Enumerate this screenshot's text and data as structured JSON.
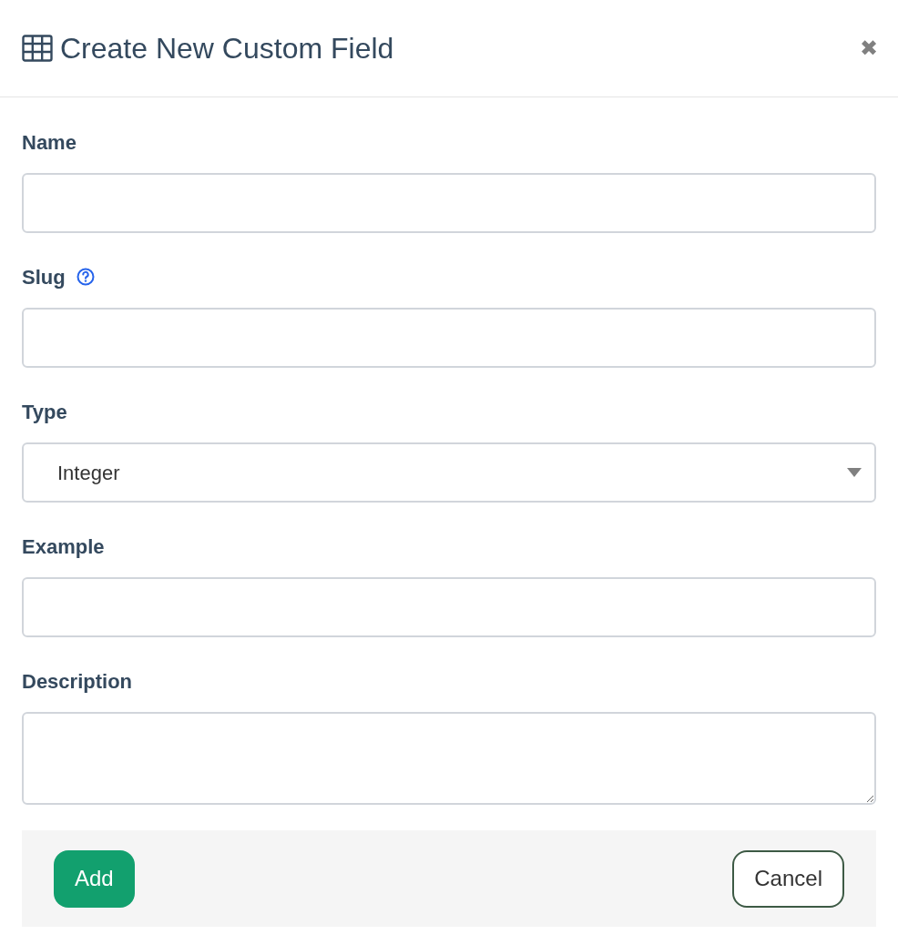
{
  "dialog": {
    "title": "Create New Custom Field",
    "close": "✖"
  },
  "fields": [
    {
      "kind": "text",
      "label": "Name",
      "has_help": false
    },
    {
      "kind": "text",
      "label": "Slug",
      "has_help": true
    },
    {
      "kind": "select",
      "label": "Type",
      "has_help": false,
      "value": "Integer"
    },
    {
      "kind": "text",
      "label": "Example",
      "has_help": false
    },
    {
      "kind": "textarea",
      "label": "Description",
      "has_help": false
    }
  ],
  "buttons": [
    {
      "kind": "primary",
      "label": "Add"
    },
    {
      "kind": "secondary",
      "label": "Cancel"
    }
  ]
}
